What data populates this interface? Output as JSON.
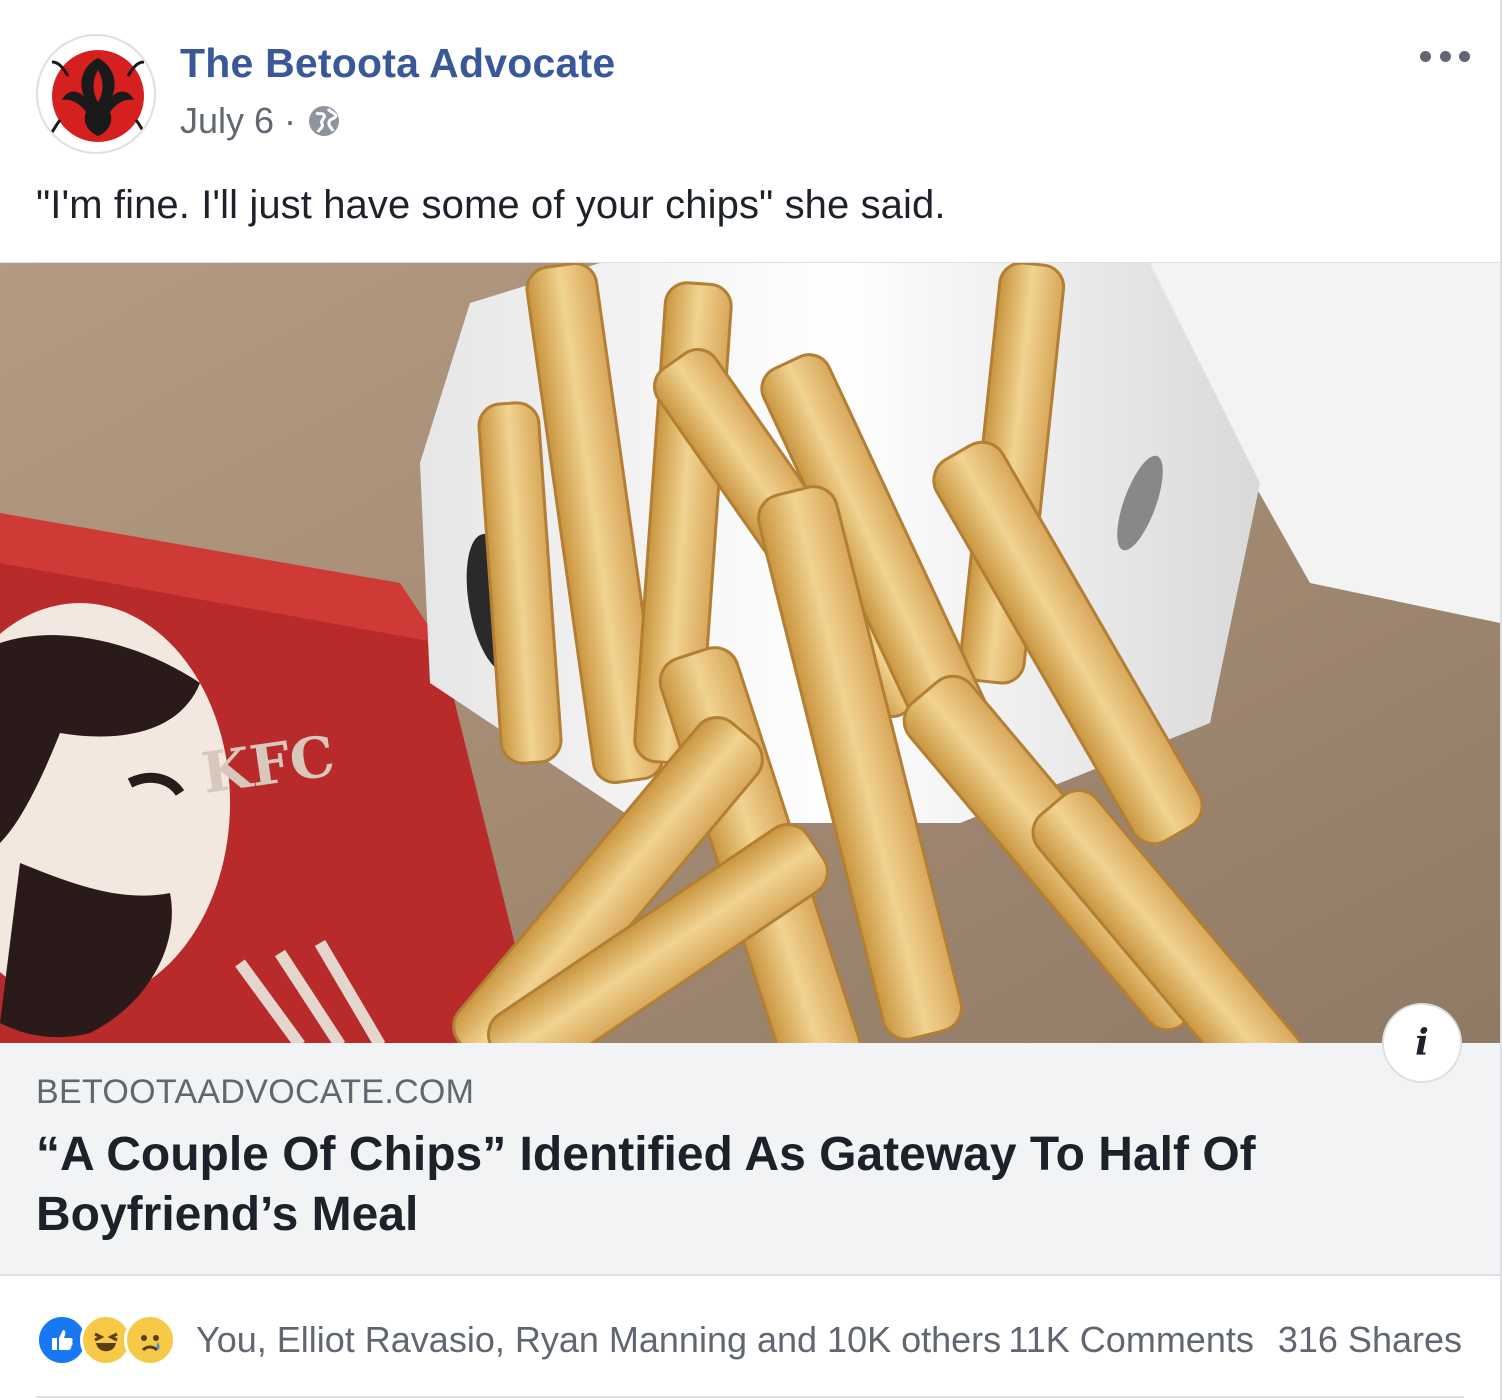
{
  "post": {
    "page_name": "The Betoota Advocate",
    "date": "July 6",
    "separator": "·",
    "privacy_icon": "globe-icon",
    "more_icon": "more-horizontal-icon",
    "text": "\"I'm fine. I'll just have some of your chips\" she said."
  },
  "link": {
    "image_icon": "article-photo",
    "domain": "BETOOTAADVOCATE.COM",
    "headline": "“A Couple Of Chips” Identified As Gateway To Half Of Boyfriend’s Meal",
    "info_label": "i"
  },
  "reactions": {
    "icons": [
      "like-icon",
      "haha-icon",
      "sad-icon"
    ],
    "names": "You, Elliot Ravasio, Ryan Manning and 10K others",
    "comments": "11K Comments",
    "shares": "316 Shares"
  },
  "colors": {
    "page_name": "#385898",
    "meta": "#606770",
    "caption_bg": "#f2f3f5",
    "like": "#1877f2",
    "emoji": "#f7c948"
  }
}
